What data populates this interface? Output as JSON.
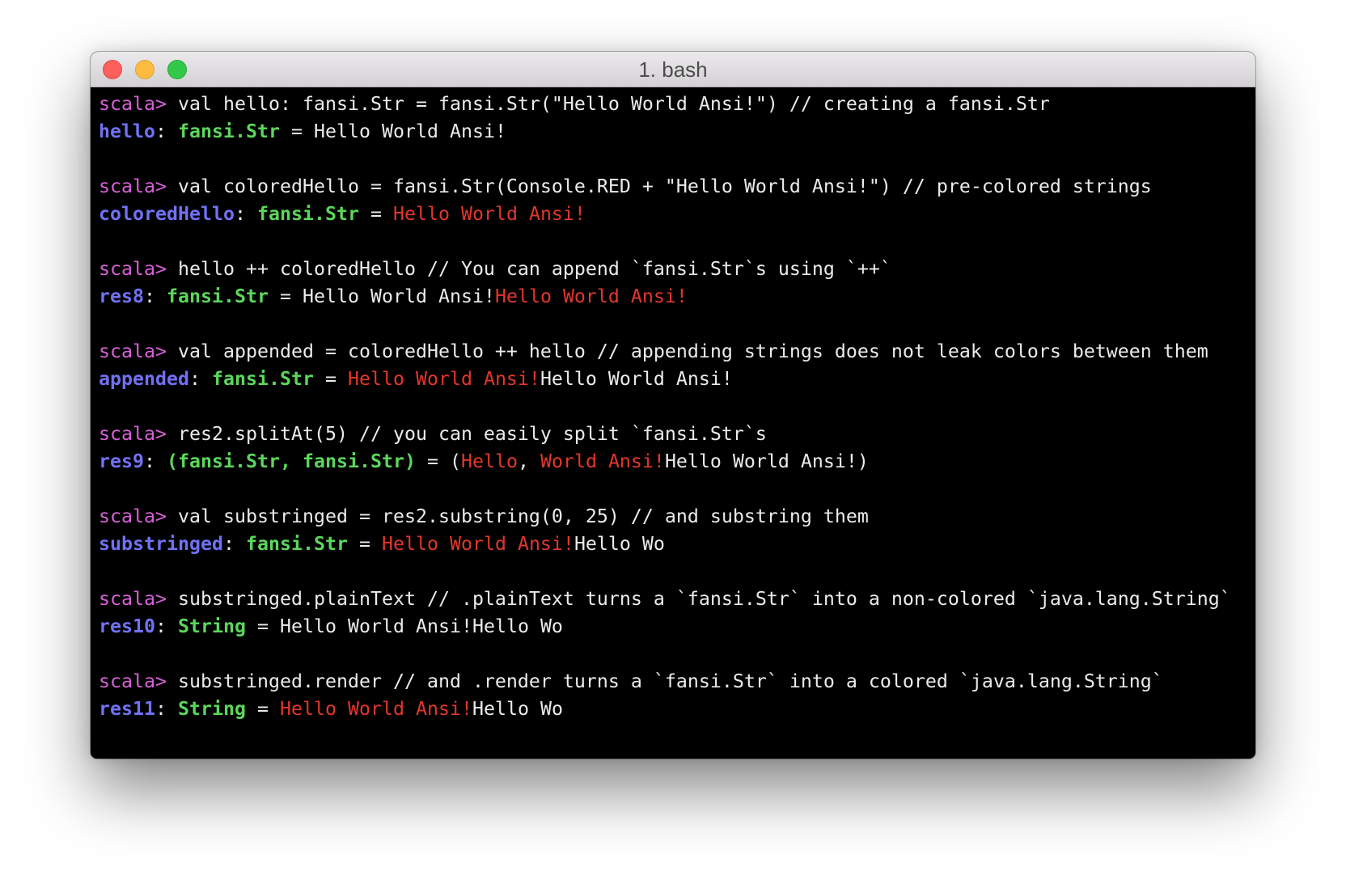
{
  "window": {
    "title": "1. bash",
    "traffic_lights": [
      {
        "icon": "close-icon",
        "color": "#FC605C",
        "border": "#DE4A46"
      },
      {
        "icon": "minimize-icon",
        "color": "#FDBC40",
        "border": "#DEA236"
      },
      {
        "icon": "zoom-icon",
        "color": "#34C84A",
        "border": "#27AA35"
      }
    ]
  },
  "terminal": {
    "prompt": "scala>",
    "palette": {
      "background": "#000000",
      "foreground": "#EBEBEB",
      "prompt": "#D660D7",
      "result_name": "#7171F5",
      "result_type": "#5BD75B",
      "ansi_red": "#E3362B"
    },
    "entries": [
      {
        "input": "val hello: fansi.Str = fansi.Str(\"Hello World Ansi!\") // creating a fansi.Str",
        "output": [
          {
            "text": "hello",
            "color": "#7171F5",
            "bold": true
          },
          {
            "text": ": "
          },
          {
            "text": "fansi.Str",
            "color": "#5BD75B",
            "bold": true
          },
          {
            "text": " = Hello World Ansi!"
          }
        ]
      },
      {
        "input": "val coloredHello = fansi.Str(Console.RED + \"Hello World Ansi!\") // pre-colored strings",
        "output": [
          {
            "text": "coloredHello",
            "color": "#7171F5",
            "bold": true
          },
          {
            "text": ": "
          },
          {
            "text": "fansi.Str",
            "color": "#5BD75B",
            "bold": true
          },
          {
            "text": " = "
          },
          {
            "text": "Hello World Ansi!",
            "color": "#E3362B"
          }
        ]
      },
      {
        "input": "hello ++ coloredHello // You can append `fansi.Str`s using `++`",
        "output": [
          {
            "text": "res8",
            "color": "#7171F5",
            "bold": true
          },
          {
            "text": ": "
          },
          {
            "text": "fansi.Str",
            "color": "#5BD75B",
            "bold": true
          },
          {
            "text": " = Hello World Ansi!"
          },
          {
            "text": "Hello World Ansi!",
            "color": "#E3362B"
          }
        ]
      },
      {
        "input": "val appended = coloredHello ++ hello // appending strings does not leak colors between them",
        "output": [
          {
            "text": "appended",
            "color": "#7171F5",
            "bold": true
          },
          {
            "text": ": "
          },
          {
            "text": "fansi.Str",
            "color": "#5BD75B",
            "bold": true
          },
          {
            "text": " = "
          },
          {
            "text": "Hello World Ansi!",
            "color": "#E3362B"
          },
          {
            "text": "Hello World Ansi!"
          }
        ]
      },
      {
        "input": "res2.splitAt(5) // you can easily split `fansi.Str`s",
        "output": [
          {
            "text": "res9",
            "color": "#7171F5",
            "bold": true
          },
          {
            "text": ": "
          },
          {
            "text": "(fansi.Str, fansi.Str)",
            "color": "#5BD75B",
            "bold": true
          },
          {
            "text": " = ("
          },
          {
            "text": "Hello",
            "color": "#E3362B"
          },
          {
            "text": ", "
          },
          {
            "text": "World Ansi!",
            "color": "#E3362B"
          },
          {
            "text": "Hello World Ansi!)"
          }
        ]
      },
      {
        "input": "val substringed = res2.substring(0, 25) // and substring them",
        "output": [
          {
            "text": "substringed",
            "color": "#7171F5",
            "bold": true
          },
          {
            "text": ": "
          },
          {
            "text": "fansi.Str",
            "color": "#5BD75B",
            "bold": true
          },
          {
            "text": " = "
          },
          {
            "text": "Hello World Ansi!",
            "color": "#E3362B"
          },
          {
            "text": "Hello Wo"
          }
        ]
      },
      {
        "input": "substringed.plainText // .plainText turns a `fansi.Str` into a non-colored `java.lang.String`",
        "output": [
          {
            "text": "res10",
            "color": "#7171F5",
            "bold": true
          },
          {
            "text": ": "
          },
          {
            "text": "String",
            "color": "#5BD75B",
            "bold": true
          },
          {
            "text": " = Hello World Ansi!Hello Wo"
          }
        ]
      },
      {
        "input": "substringed.render // and .render turns a `fansi.Str` into a colored `java.lang.String`",
        "output": [
          {
            "text": "res11",
            "color": "#7171F5",
            "bold": true
          },
          {
            "text": ": "
          },
          {
            "text": "String",
            "color": "#5BD75B",
            "bold": true
          },
          {
            "text": " = "
          },
          {
            "text": "Hello World Ansi!",
            "color": "#E3362B"
          },
          {
            "text": "Hello Wo"
          }
        ]
      }
    ]
  }
}
